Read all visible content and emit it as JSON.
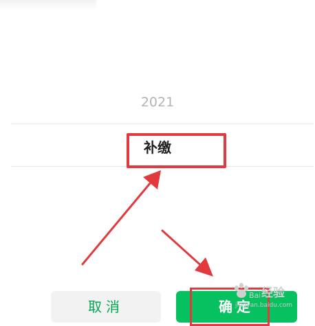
{
  "picker": {
    "options": [
      "2021"
    ],
    "selected": "补缴"
  },
  "buttons": {
    "cancel": "取消",
    "confirm": "确定"
  },
  "watermark": {
    "brand": "Bai",
    "title": "经验",
    "url": "jingyan.baidu.com"
  },
  "colors": {
    "accent_green": "#07c160",
    "annotation_red": "#e0393e"
  }
}
